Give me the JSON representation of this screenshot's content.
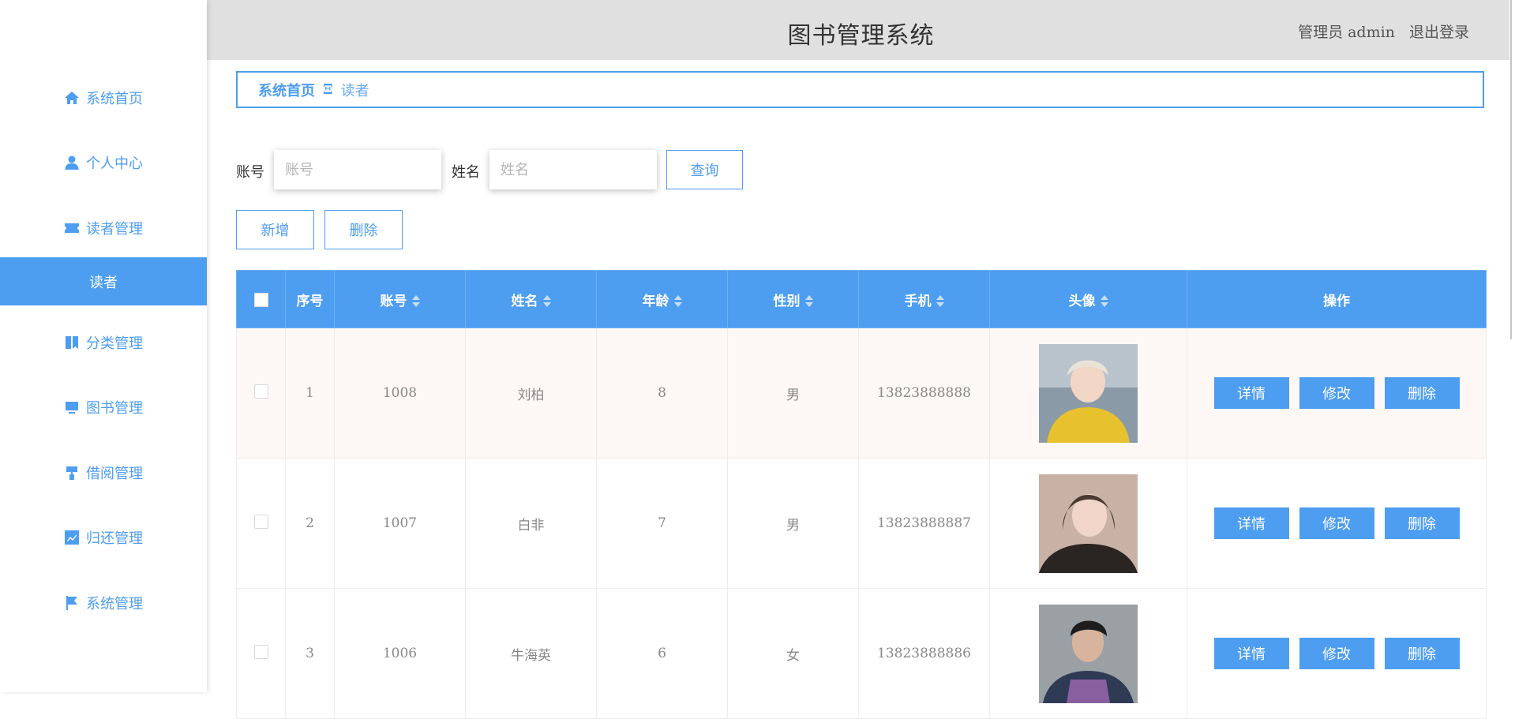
{
  "header": {
    "title": "图书管理系统",
    "user": "管理员 admin",
    "logout": "退出登录"
  },
  "sidebar": {
    "items": [
      {
        "label": "系统首页",
        "icon": "home-icon"
      },
      {
        "label": "个人中心",
        "icon": "user-icon"
      },
      {
        "label": "读者管理",
        "icon": "ticket-icon"
      },
      {
        "label": "分类管理",
        "icon": "book-icon"
      },
      {
        "label": "图书管理",
        "icon": "monitor-icon"
      },
      {
        "label": "借阅管理",
        "icon": "paint-roller-icon"
      },
      {
        "label": "归还管理",
        "icon": "chart-icon"
      },
      {
        "label": "系统管理",
        "icon": "flag-icon"
      }
    ],
    "active_sub": "读者"
  },
  "breadcrumb": {
    "home": "系统首页",
    "separator": "Ξ",
    "current": "读者"
  },
  "search": {
    "account_label": "账号",
    "account_placeholder": "账号",
    "name_label": "姓名",
    "name_placeholder": "姓名",
    "query_button": "查询"
  },
  "actions": {
    "add": "新增",
    "delete": "删除"
  },
  "table": {
    "headers": [
      "序号",
      "账号",
      "姓名",
      "年龄",
      "性别",
      "手机",
      "头像",
      "操作"
    ],
    "rows": [
      {
        "index": "1",
        "account": "1008",
        "name": "刘柏",
        "age": "8",
        "gender": "男",
        "phone": "13823888888"
      },
      {
        "index": "2",
        "account": "1007",
        "name": "白非",
        "age": "7",
        "gender": "男",
        "phone": "13823888887"
      },
      {
        "index": "3",
        "account": "1006",
        "name": "牛海英",
        "age": "6",
        "gender": "女",
        "phone": "13823888886"
      }
    ],
    "op_labels": {
      "detail": "详情",
      "edit": "修改",
      "delete": "删除"
    }
  },
  "colors": {
    "primary": "#4d9df0",
    "header_bg": "#e0e0e0",
    "highlight_row": "#fdf7f5"
  }
}
